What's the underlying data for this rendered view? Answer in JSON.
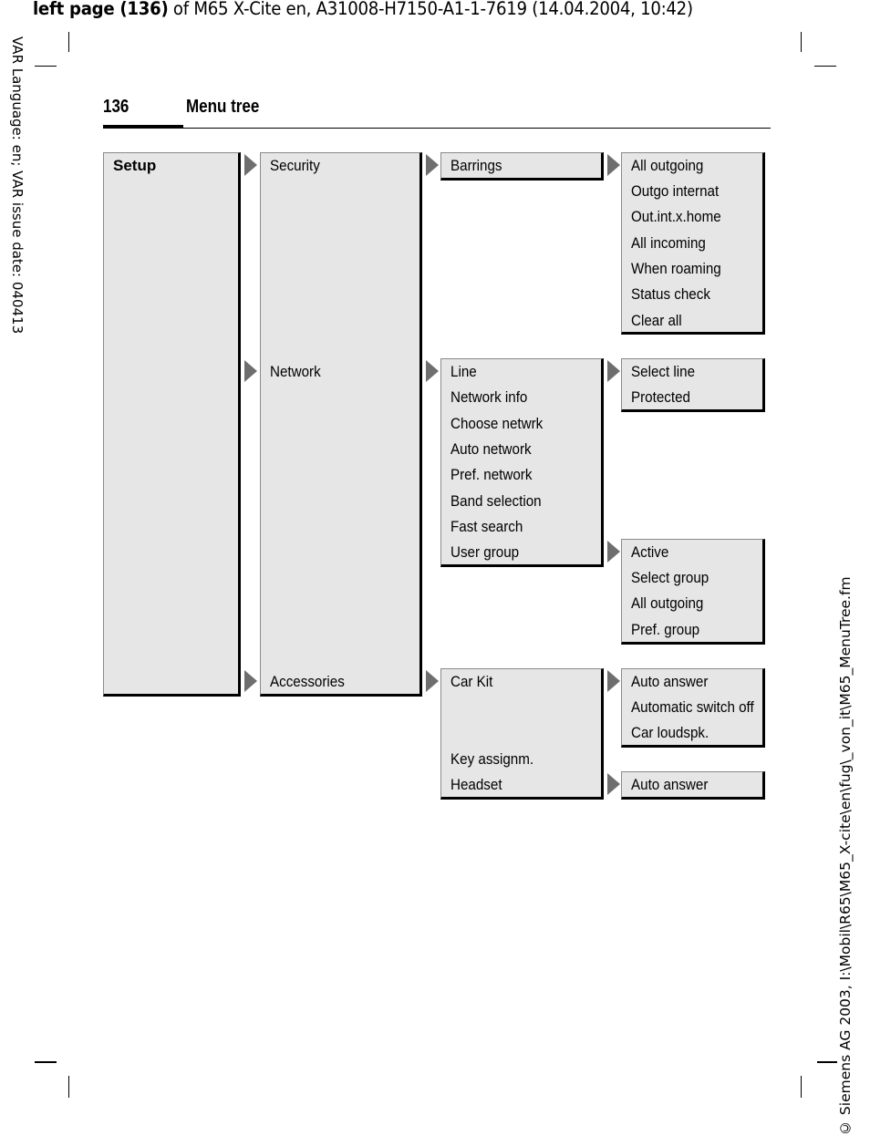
{
  "slug": {
    "bold": "left page (136)",
    "rest": " of M65 X-Cite en, A31008-H7150-A1-1-7619 (14.04.2004, 10:42)"
  },
  "margin_left": "VAR Language: en; VAR issue date: 040413",
  "margin_right": "© Siemens AG 2003, I:\\Mobil\\R65\\M65_X-cite\\en\\fug\\_von_it\\M65_MenuTree.fm",
  "header": {
    "page_number": "136",
    "title": "Menu tree"
  },
  "menu": {
    "root": "Setup",
    "level2": [
      "Security",
      "Network",
      "Accessories"
    ],
    "security": {
      "items": [
        "Barrings"
      ],
      "barrings": [
        "All outgoing",
        "Outgo internat",
        "Out.int.x.home",
        "All incoming",
        "When roaming",
        "Status check",
        "Clear all"
      ]
    },
    "network": {
      "items": [
        "Line",
        "Network info",
        "Choose netwrk",
        "Auto network",
        "Pref. network",
        "Band selection",
        "Fast search",
        "User group"
      ],
      "line": [
        "Select line",
        "Protected"
      ],
      "user_group": [
        "Active",
        "Select group",
        "All outgoing",
        "Pref. group"
      ]
    },
    "accessories": {
      "items": [
        "Car Kit",
        "Key assignm.",
        "Headset"
      ],
      "car_kit": [
        "Auto answer",
        "Automatic switch off",
        "Car loudspk."
      ],
      "headset": [
        "Auto answer"
      ]
    }
  },
  "icons": {
    "submenu": "triangle-right-icon"
  }
}
